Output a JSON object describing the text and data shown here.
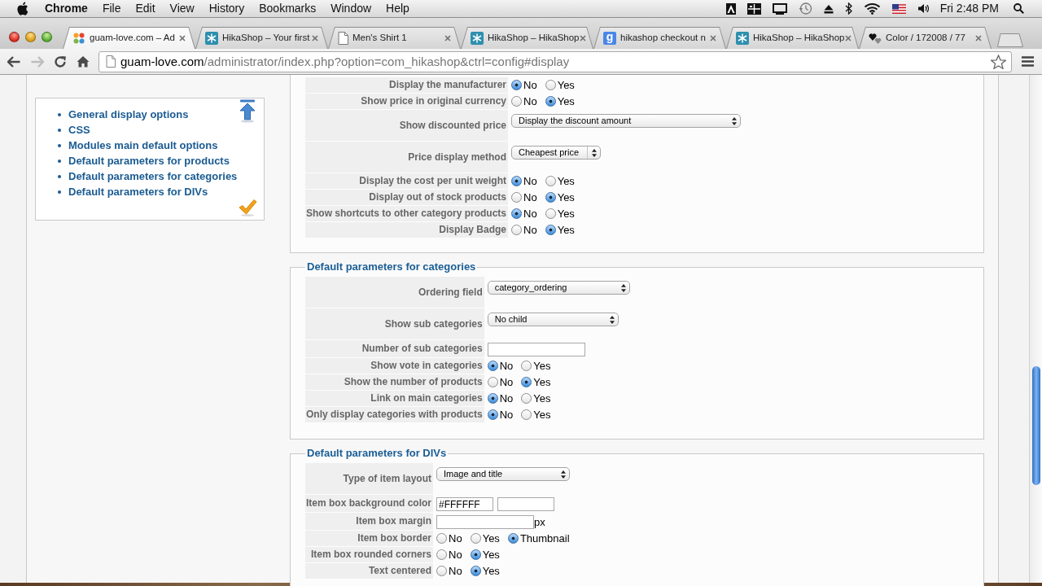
{
  "menu_bar": {
    "app_name": "Chrome",
    "menus": [
      "File",
      "Edit",
      "View",
      "History",
      "Bookmarks",
      "Window",
      "Help"
    ],
    "clock": "Fri 2:48 PM"
  },
  "browser": {
    "tabs": [
      {
        "title": "guam-love.com – Ad",
        "kind": "pinwheel",
        "selected": true
      },
      {
        "title": "HikaShop – Your first",
        "kind": "tile",
        "selected": false
      },
      {
        "title": "Men's Shirt 1",
        "kind": "page",
        "selected": false
      },
      {
        "title": "HikaShop – HikaShop",
        "kind": "tile",
        "selected": false
      },
      {
        "title": "hikashop checkout n",
        "kind": "letter",
        "icon_letter": "g",
        "selected": false
      },
      {
        "title": "HikaShop – HikaShop",
        "kind": "tile",
        "selected": false
      },
      {
        "title": "Color / 172008 / 77",
        "kind": "hearts",
        "selected": false
      }
    ],
    "forward_disabled": true,
    "address": {
      "host": "guam-love.com",
      "path": "/administrator/index.php?option=com_hikashop&ctrl=config#display"
    }
  },
  "sidebar": {
    "links": [
      "General display options",
      "CSS",
      "Modules main default options",
      "Default parameters for products",
      "Default parameters for categories",
      "Default parameters for DIVs"
    ]
  },
  "sections": [
    {
      "rows": [
        {
          "label": "Display the manufacturer",
          "kind": "radio",
          "options": [
            {
              "label": "No",
              "selected": true
            },
            {
              "label": "Yes",
              "selected": false
            }
          ]
        },
        {
          "label": "Show price in original currency",
          "kind": "radio",
          "options": [
            {
              "label": "No",
              "selected": false
            },
            {
              "label": "Yes",
              "selected": true
            }
          ]
        },
        {
          "label": "Show discounted price",
          "kind": "select",
          "value": "Display the discount amount"
        },
        {
          "label": "Price display method",
          "kind": "select",
          "value": "Cheapest price"
        },
        {
          "label": "Display the cost per unit weight",
          "kind": "radio",
          "options": [
            {
              "label": "No",
              "selected": true
            },
            {
              "label": "Yes",
              "selected": false
            }
          ]
        },
        {
          "label": "Display out of stock products",
          "kind": "radio",
          "options": [
            {
              "label": "No",
              "selected": false
            },
            {
              "label": "Yes",
              "selected": true
            }
          ]
        },
        {
          "label": "Show shortcuts to other category products",
          "kind": "radio",
          "options": [
            {
              "label": "No",
              "selected": true
            },
            {
              "label": "Yes",
              "selected": false
            }
          ]
        },
        {
          "label": "Display Badge",
          "kind": "radio",
          "options": [
            {
              "label": "No",
              "selected": false
            },
            {
              "label": "Yes",
              "selected": true
            }
          ]
        }
      ]
    },
    {
      "legend": "Default parameters for categories",
      "rows": [
        {
          "label": "Ordering field",
          "kind": "select",
          "value": "category_ordering"
        },
        {
          "label": "Show sub categories",
          "kind": "select",
          "value": "No child"
        },
        {
          "label": "Number of sub categories",
          "kind": "text"
        },
        {
          "label": "Show vote in categories",
          "kind": "radio",
          "options": [
            {
              "label": "No",
              "selected": true
            },
            {
              "label": "Yes",
              "selected": false
            }
          ]
        },
        {
          "label": "Show the number of products",
          "kind": "radio",
          "options": [
            {
              "label": "No",
              "selected": false
            },
            {
              "label": "Yes",
              "selected": true
            }
          ]
        },
        {
          "label": "Link on main categories",
          "kind": "radio",
          "options": [
            {
              "label": "No",
              "selected": true
            },
            {
              "label": "Yes",
              "selected": false
            }
          ]
        },
        {
          "label": "Only display categories with products",
          "kind": "radio",
          "options": [
            {
              "label": "No",
              "selected": true
            },
            {
              "label": "Yes",
              "selected": false
            }
          ]
        }
      ]
    },
    {
      "legend": "Default parameters for DIVs",
      "rows": [
        {
          "label": "Type of item layout",
          "kind": "select",
          "value": "Image and title"
        },
        {
          "label": "Item box background color",
          "kind": "color",
          "value": "#FFFFFF"
        },
        {
          "label": "Item box margin",
          "kind": "text",
          "unit": "px"
        },
        {
          "label": "Item box border",
          "kind": "radio",
          "options": [
            {
              "label": "No",
              "selected": false
            },
            {
              "label": "Yes",
              "selected": false
            },
            {
              "label": "Thumbnail",
              "selected": true
            }
          ]
        },
        {
          "label": "Item box rounded corners",
          "kind": "radio",
          "options": [
            {
              "label": "No",
              "selected": false
            },
            {
              "label": "Yes",
              "selected": true
            }
          ]
        },
        {
          "label": "Text centered",
          "kind": "radio",
          "options": [
            {
              "label": "No",
              "selected": false
            },
            {
              "label": "Yes",
              "selected": true
            }
          ]
        }
      ]
    }
  ]
}
